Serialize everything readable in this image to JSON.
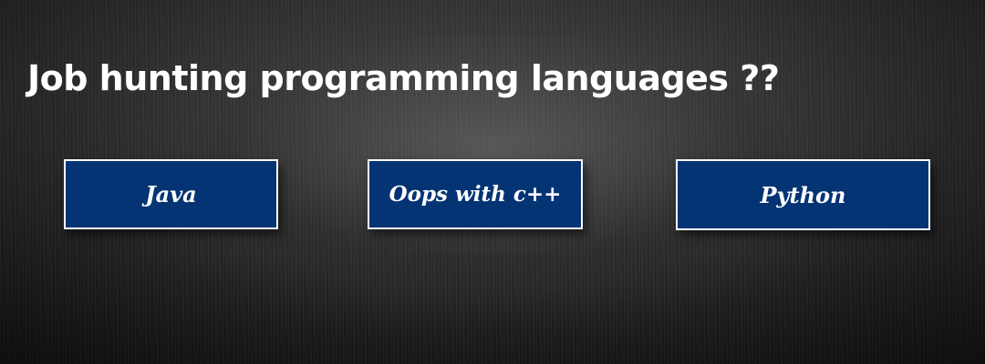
{
  "slide": {
    "title": "Job hunting programming languages ??",
    "colors": {
      "box_fill": "#043474",
      "box_border": "#ffffff",
      "text": "#ffffff"
    },
    "boxes": [
      {
        "label": "Java"
      },
      {
        "label": "Oops with c++"
      },
      {
        "label": "Python"
      }
    ]
  }
}
